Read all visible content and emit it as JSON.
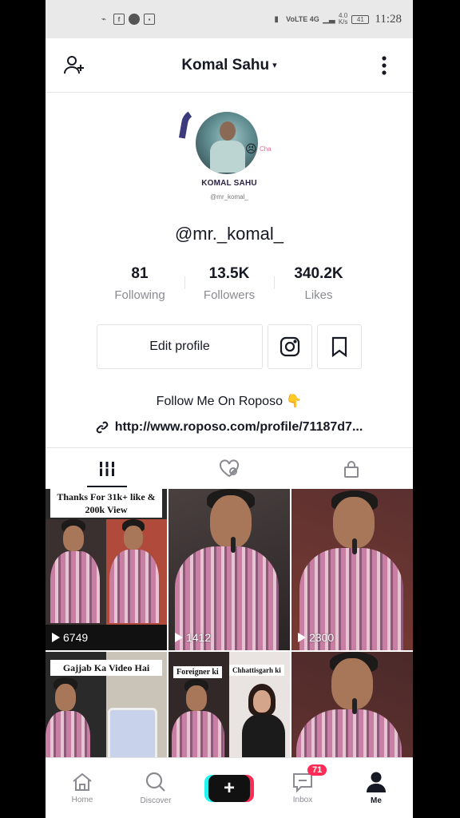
{
  "status_bar": {
    "left_icons": [
      "usb-icon",
      "facebook-icon",
      "circle-icon",
      "app-icon"
    ],
    "network": "VoLTE 4G",
    "speed_top": "4.0",
    "speed_bottom": "K/s",
    "battery": "41",
    "time": "11:28"
  },
  "header": {
    "title": "Komal Sahu",
    "caret": "▾"
  },
  "profile": {
    "avatar_name": "KOMAL SAHU",
    "avatar_handle": "@mr_komal_",
    "avatar_tag": "Cha",
    "username": "@mr._komal_",
    "stats": [
      {
        "value": "81",
        "label": "Following"
      },
      {
        "value": "13.5K",
        "label": "Followers"
      },
      {
        "value": "340.2K",
        "label": "Likes"
      }
    ],
    "edit_label": "Edit profile",
    "bio": "Follow Me On Roposo 👇",
    "link": "http://www.roposo.com/profile/71187d7..."
  },
  "tabs": [
    {
      "name": "videos",
      "icon": "grid-icon",
      "active": true
    },
    {
      "name": "liked",
      "icon": "liked-hidden-icon",
      "active": false
    },
    {
      "name": "private",
      "icon": "lock-icon",
      "active": false
    }
  ],
  "videos": [
    {
      "views": "6749",
      "caption": "Thanks For 31k+ like & 200k View"
    },
    {
      "views": "1412",
      "caption": ""
    },
    {
      "views": "2300",
      "caption": ""
    },
    {
      "views": "",
      "caption": "Gajjab Ka Video Hai"
    },
    {
      "views": "",
      "caption": "",
      "tags": [
        "Foreigner ki",
        "Chhattisgarh ki"
      ]
    },
    {
      "views": "",
      "caption": ""
    }
  ],
  "bottom_nav": [
    {
      "label": "Home",
      "icon": "home-icon"
    },
    {
      "label": "Discover",
      "icon": "search-icon"
    },
    {
      "label": "",
      "icon": "plus-icon"
    },
    {
      "label": "Inbox",
      "icon": "inbox-icon",
      "badge": "71"
    },
    {
      "label": "Me",
      "icon": "profile-icon",
      "active": true
    }
  ]
}
